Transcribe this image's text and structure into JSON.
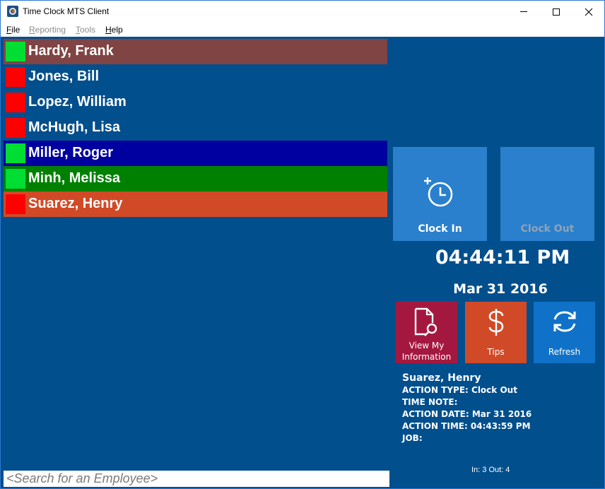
{
  "window": {
    "title": "Time Clock MTS Client",
    "controls": {
      "minimize": "minimize",
      "maximize": "maximize",
      "close": "close"
    }
  },
  "menu": [
    {
      "label": "File",
      "accel": "F",
      "rest": "ile",
      "enabled": true
    },
    {
      "label": "Reporting",
      "accel": "R",
      "rest": "eporting",
      "enabled": false
    },
    {
      "label": "Tools",
      "accel": "T",
      "rest": "ools",
      "enabled": false
    },
    {
      "label": "Help",
      "accel": "H",
      "rest": "elp",
      "enabled": true
    }
  ],
  "employees": [
    {
      "name": "Hardy, Frank",
      "status": "in",
      "status_color": "#00dd33",
      "row_color": "#804444"
    },
    {
      "name": "Jones, Bill",
      "status": "out",
      "status_color": "#ff0000",
      "row_color": ""
    },
    {
      "name": "Lopez, William",
      "status": "out",
      "status_color": "#ff0000",
      "row_color": ""
    },
    {
      "name": "McHugh, Lisa",
      "status": "out",
      "status_color": "#ff0000",
      "row_color": ""
    },
    {
      "name": "Miller, Roger",
      "status": "in",
      "status_color": "#00dd33",
      "row_color": "#0000a0"
    },
    {
      "name": "Minh, Melissa",
      "status": "in",
      "status_color": "#00dd33",
      "row_color": "#008000"
    },
    {
      "name": "Suarez, Henry",
      "status": "out",
      "status_color": "#ff0000",
      "row_color": "#d14a27"
    }
  ],
  "actions": {
    "clock_in": {
      "label": "Clock In",
      "icon": "clock-plus-icon",
      "enabled": true
    },
    "clock_out": {
      "label": "Clock Out",
      "enabled": false
    },
    "view_info": {
      "label_line1": "View My",
      "label_line2": "Information",
      "icon": "document-search-icon"
    },
    "tips": {
      "label": "Tips",
      "icon": "dollar-icon"
    },
    "refresh": {
      "label": "Refresh",
      "icon": "refresh-icon"
    }
  },
  "clock": {
    "time": "04:44:11 PM",
    "date": "Mar 31 2016"
  },
  "last_action": {
    "employee": "Suarez, Henry",
    "action_type": "ACTION TYPE: Clock Out",
    "time_note": "TIME NOTE:",
    "action_date": "ACTION DATE: Mar 31 2016",
    "action_time": "ACTION TIME: 04:43:59 PM",
    "job": "JOB:"
  },
  "counts": "In: 3 Out: 4",
  "search": {
    "placeholder": "<Search for an Employee>",
    "value": ""
  }
}
